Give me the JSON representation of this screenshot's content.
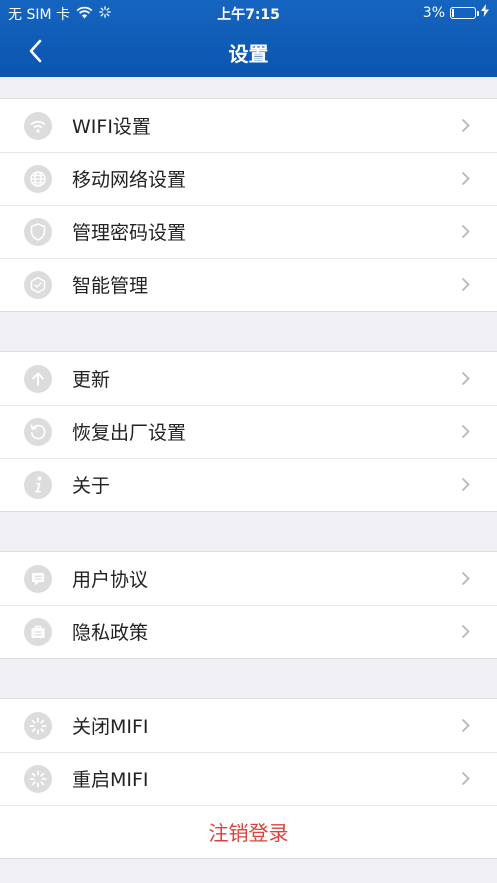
{
  "status_bar": {
    "carrier": "无 SIM 卡",
    "time": "上午7:15",
    "battery": "3%"
  },
  "nav": {
    "title": "设置"
  },
  "groups": [
    {
      "items": [
        {
          "label": "WIFI设置",
          "icon": "wifi-icon"
        },
        {
          "label": "移动网络设置",
          "icon": "globe-icon"
        },
        {
          "label": "管理密码设置",
          "icon": "shield-icon"
        },
        {
          "label": "智能管理",
          "icon": "gear-icon"
        }
      ]
    },
    {
      "items": [
        {
          "label": "更新",
          "icon": "arrow-up-icon"
        },
        {
          "label": "恢复出厂设置",
          "icon": "restore-icon"
        },
        {
          "label": "关于",
          "icon": "info-icon"
        }
      ]
    },
    {
      "items": [
        {
          "label": "用户协议",
          "icon": "message-icon"
        },
        {
          "label": "隐私政策",
          "icon": "briefcase-icon"
        }
      ]
    },
    {
      "items": [
        {
          "label": "关闭MIFI",
          "icon": "loading-icon"
        },
        {
          "label": "重启MIFI",
          "icon": "loading-icon"
        }
      ]
    }
  ],
  "logout_label": "注销登录",
  "colors": {
    "header": "#1565c0",
    "background": "#efeff4",
    "icon_bg": "#dcdcdc",
    "logout": "#e0403a"
  }
}
